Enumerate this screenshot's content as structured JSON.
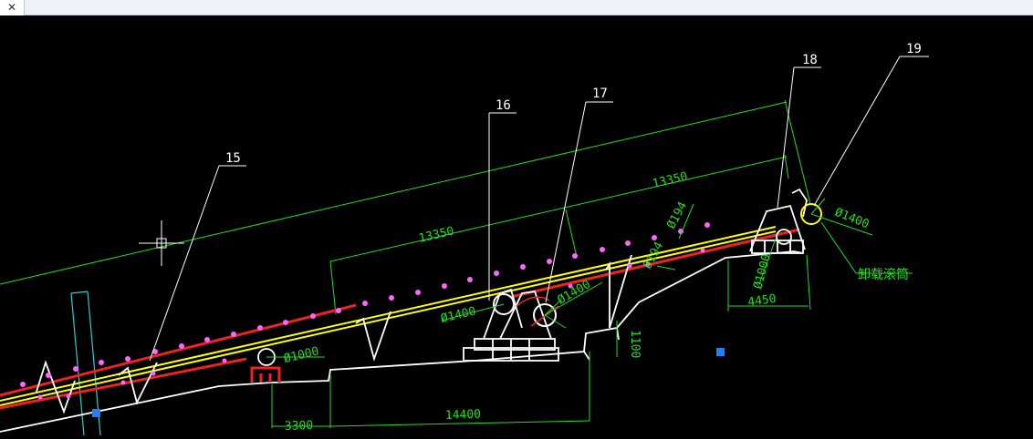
{
  "tab": {
    "close_glyph": "✕"
  },
  "colors": {
    "background": "#000000",
    "dimension": "#22dd22",
    "structure": "#ffffff",
    "belt_upper": "#ffff00",
    "belt_lower": "#ee2222",
    "idler_marker": "#ff66ff",
    "grip": "#1e7fff",
    "cyan_line": "#33cccc"
  },
  "callouts": {
    "c15": "15",
    "c16": "16",
    "c17": "17",
    "c18": "18",
    "c19": "19"
  },
  "dimensions": {
    "d_13350_upper": "13350",
    "d_13350_lower": "13350",
    "d_dia1000_a": "Ø1000",
    "d_dia1400_a": "Ø1400",
    "d_dia1400_b": "Ø1400",
    "d_dia1400_c": "Ø1400",
    "d_dia194_a": "Ø194",
    "d_dia194_b": "Ø194",
    "d_dia1000_b": "Ø1000",
    "d_4450": "4450",
    "d_1100": "1100",
    "d_3300": "3300",
    "d_14400": "14400"
  },
  "notes": {
    "discharge_pulley": "卸载滚筒"
  }
}
